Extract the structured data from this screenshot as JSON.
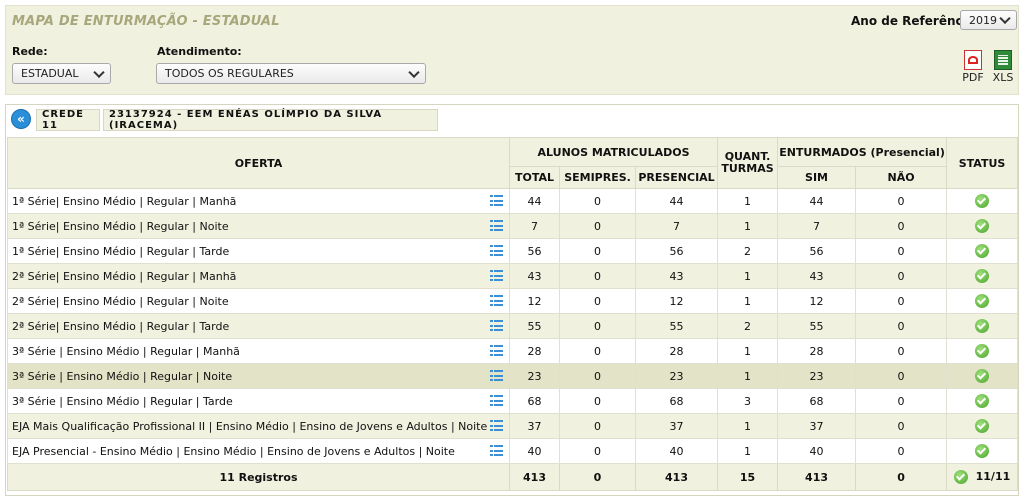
{
  "header": {
    "title": "MAPA DE ENTURMAÇÃO - ESTADUAL",
    "year_label": "Ano de Referência:",
    "year_value": "2019"
  },
  "filters": {
    "rede_label": "Rede:",
    "rede_value": "ESTADUAL",
    "atendimento_label": "Atendimento:",
    "atendimento_value": "TODOS OS REGULARES"
  },
  "exports": {
    "pdf": "PDF",
    "xls": "XLS"
  },
  "breadcrumb": {
    "back_icon": "«",
    "crede": "CREDE 11",
    "school": "23137924 - EEM ENÉAS OLÍMPIO DA SILVA (IRACEMA)"
  },
  "table": {
    "headers": {
      "oferta": "OFERTA",
      "alunos": "ALUNOS MATRICULADOS",
      "total": "TOTAL",
      "semipres": "SEMIPRES.",
      "presencial": "PRESENCIAL",
      "quant": "QUANT.",
      "turmas": "TURMAS",
      "enturmados": "ENTURMADOS (Presencial)",
      "sim": "SIM",
      "nao": "NÃO",
      "status": "STATUS"
    },
    "rows": [
      {
        "oferta": "1ª Série| Ensino Médio | Regular | Manhã",
        "total": "44",
        "semipres": "0",
        "presencial": "44",
        "turmas": "1",
        "sim": "44",
        "nao": "0"
      },
      {
        "oferta": "1ª Série| Ensino Médio | Regular | Noite",
        "total": "7",
        "semipres": "0",
        "presencial": "7",
        "turmas": "1",
        "sim": "7",
        "nao": "0"
      },
      {
        "oferta": "1ª Série| Ensino Médio | Regular | Tarde",
        "total": "56",
        "semipres": "0",
        "presencial": "56",
        "turmas": "2",
        "sim": "56",
        "nao": "0"
      },
      {
        "oferta": "2ª Série| Ensino Médio | Regular | Manhã",
        "total": "43",
        "semipres": "0",
        "presencial": "43",
        "turmas": "1",
        "sim": "43",
        "nao": "0"
      },
      {
        "oferta": "2ª Série| Ensino Médio | Regular | Noite",
        "total": "12",
        "semipres": "0",
        "presencial": "12",
        "turmas": "1",
        "sim": "12",
        "nao": "0"
      },
      {
        "oferta": "2ª Série| Ensino Médio | Regular | Tarde",
        "total": "55",
        "semipres": "0",
        "presencial": "55",
        "turmas": "2",
        "sim": "55",
        "nao": "0"
      },
      {
        "oferta": "3ª Série | Ensino Médio | Regular | Manhã",
        "total": "28",
        "semipres": "0",
        "presencial": "28",
        "turmas": "1",
        "sim": "28",
        "nao": "0"
      },
      {
        "oferta": "3ª Série | Ensino Médio | Regular | Noite",
        "total": "23",
        "semipres": "0",
        "presencial": "23",
        "turmas": "1",
        "sim": "23",
        "nao": "0"
      },
      {
        "oferta": "3ª Série | Ensino Médio | Regular | Tarde",
        "total": "68",
        "semipres": "0",
        "presencial": "68",
        "turmas": "3",
        "sim": "68",
        "nao": "0"
      },
      {
        "oferta": "EJA Mais Qualificação Profissional II | Ensino Médio | Ensino de Jovens e Adultos | Noite",
        "total": "37",
        "semipres": "0",
        "presencial": "37",
        "turmas": "1",
        "sim": "37",
        "nao": "0"
      },
      {
        "oferta": "EJA Presencial - Ensino Médio | Ensino Médio | Ensino de Jovens e Adultos | Noite",
        "total": "40",
        "semipres": "0",
        "presencial": "40",
        "turmas": "1",
        "sim": "40",
        "nao": "0"
      }
    ],
    "footer": {
      "registros": "11 Registros",
      "total": "413",
      "semipres": "0",
      "presencial": "413",
      "turmas": "15",
      "sim": "413",
      "nao": "0",
      "status": "11/11"
    }
  },
  "colors": {
    "accent": "#a7a77c",
    "panel": "#f1f1e0",
    "highlight": "#e3e3c7",
    "ok_green": "#4aa32b",
    "link_blue": "#2a8fd8"
  },
  "icons": {
    "row_action": "list-icon",
    "status": "check-circle-icon",
    "back": "double-chevron-left-icon"
  }
}
